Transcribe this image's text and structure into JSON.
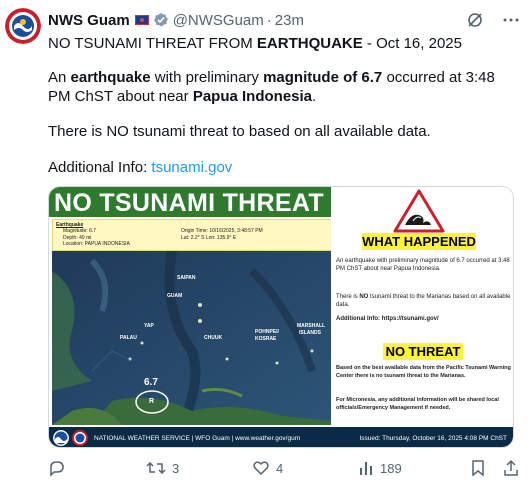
{
  "tweet": {
    "author_name": "NWS Guam",
    "handle": "@NWSGuam",
    "separator": "·",
    "time": "23m",
    "line1_a": "NO TSUNAMI THREAT FROM ",
    "line1_b": "EARTHQUAKE",
    "line1_c": " - Oct 16, 2025",
    "line2_a": "An ",
    "line2_b": "earthquake",
    "line2_c": " with preliminary ",
    "line2_d": "magnitude of 6.7",
    "line2_e": " occurred at 3:48 PM ChST about near ",
    "line2_f": "Papua Indonesia",
    "line2_g": ".",
    "line3": "There is NO tsunami threat to based on all available data.",
    "line4_a": "Additional Info: ",
    "line4_link": "tsunami.gov"
  },
  "card": {
    "title": "NO TSUNAMI THREAT",
    "info_heading": "Earthquake",
    "magnitude": "Magnitude: 6.7",
    "depth": "Depth: 49 mi",
    "location": "Location: PAPUA INDONESIA",
    "origin_time": "Origin Time: 10/16/2025, 3:48:57 PM",
    "lat_lon": "Lat: 2.2° S  Lon: 135.9° E",
    "map_labels": {
      "saipan": "SAIPAN",
      "guam": "GUAM",
      "yap": "YAP",
      "palau": "PALAU",
      "chuuk": "CHUUK",
      "pohnpei": "POHNPEI/",
      "kosrae": "KOSRAE",
      "marshall1": "MARSHALL",
      "marshall2": "ISLANDS"
    },
    "quake_mag": "6.7",
    "quake_marker": "R",
    "what_happened": "WHAT HAPPENED",
    "wh_text1": "An earthquake with preliminary magnitude of 6.7 occurred at 3:48 PM ChST about near Papua Indonesia.",
    "wh_text2_a": "There is ",
    "wh_text2_b": "NO",
    "wh_text2_c": " tsunami threat to the Marianas based on all available data.",
    "wh_text3": "Additional Info: https://tsunami.gov/",
    "no_threat": "NO THREAT",
    "nt_text1": "Based on the best available data from the Pacific Tsunami Warning Center there is no tsunami threat to the Marianas.",
    "nt_text2": "For Micronesia, any additional information will be shared local officials/Emergency Management if needed.",
    "footer_left": "NATIONAL WEATHER SERVICE | WFO Guam | www.weather.gov/gum",
    "footer_right": "Issued: Thursday, October 16, 2025 4:08 PM ChST"
  },
  "actions": {
    "replies": "",
    "retweets": "3",
    "likes": "4",
    "views": "189"
  },
  "colors": {
    "link": "#1d9bf0",
    "muted": "#536471",
    "title_bar": "#2f7a2f",
    "highlight": "#fff23a",
    "footer": "#0a2a45"
  }
}
